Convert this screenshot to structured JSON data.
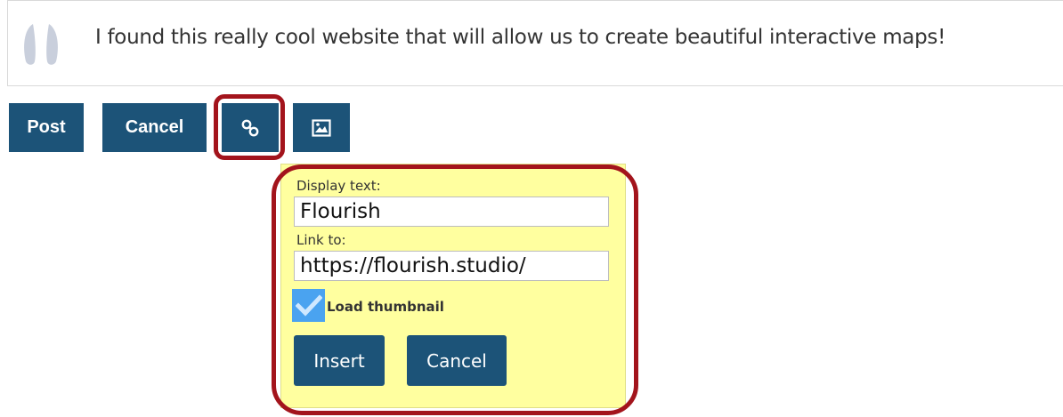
{
  "comment": {
    "text": "I found this really cool website that will allow us to create beautiful interactive maps!"
  },
  "toolbar": {
    "post_label": "Post",
    "cancel_label": "Cancel",
    "link_icon": "link-icon",
    "image_icon": "image-icon"
  },
  "link_dialog": {
    "display_text_label": "Display text:",
    "display_text_value": "Flourish",
    "link_to_label": "Link to:",
    "link_to_value": "https://flourish.studio/",
    "load_thumbnail_label": "Load thumbnail",
    "load_thumbnail_checked": true,
    "insert_label": "Insert",
    "cancel_label": "Cancel"
  },
  "colors": {
    "button_bg": "#1c5378",
    "popup_bg": "#ffff9f",
    "highlight": "#a3141c",
    "checkbox": "#4aa3f0"
  }
}
